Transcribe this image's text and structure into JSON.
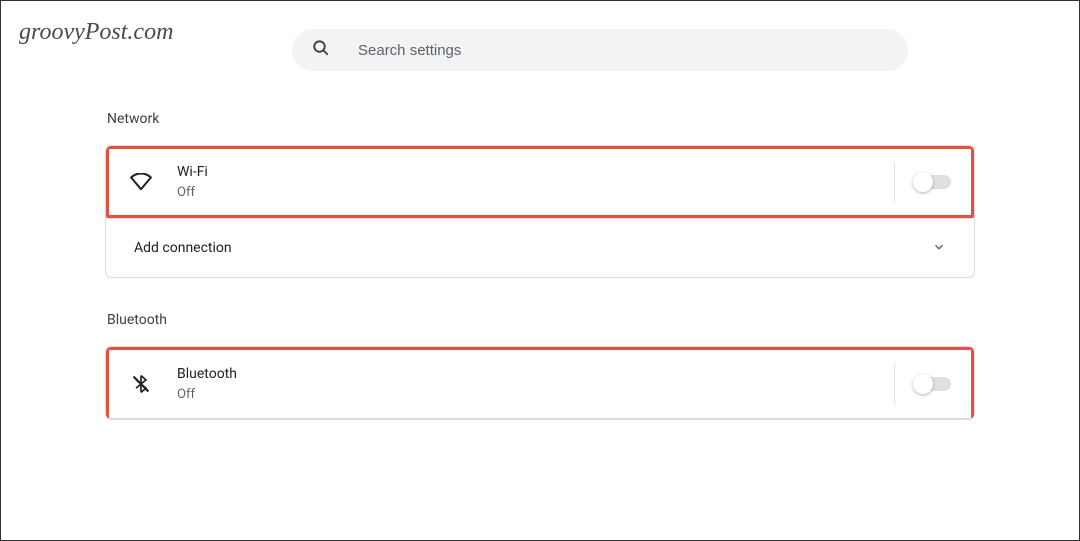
{
  "watermark": "groovyPost.com",
  "search": {
    "placeholder": "Search settings"
  },
  "sections": {
    "network": {
      "title": "Network",
      "wifi": {
        "label": "Wi-Fi",
        "status": "Off"
      },
      "add_connection": {
        "label": "Add connection"
      }
    },
    "bluetooth": {
      "title": "Bluetooth",
      "bluetooth": {
        "label": "Bluetooth",
        "status": "Off"
      }
    }
  }
}
